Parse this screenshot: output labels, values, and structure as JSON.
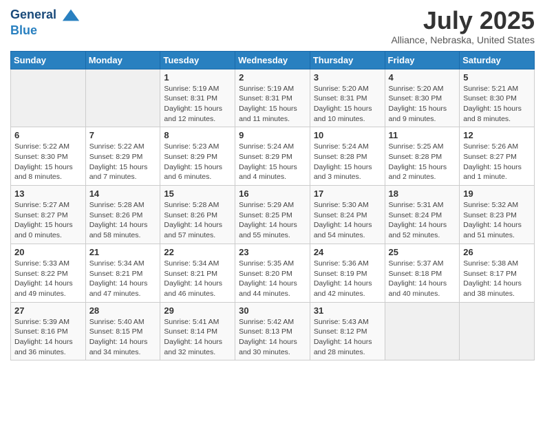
{
  "logo": {
    "line1": "General",
    "line2": "Blue"
  },
  "title": "July 2025",
  "location": "Alliance, Nebraska, United States",
  "days_header": [
    "Sunday",
    "Monday",
    "Tuesday",
    "Wednesday",
    "Thursday",
    "Friday",
    "Saturday"
  ],
  "weeks": [
    [
      {
        "num": "",
        "detail": ""
      },
      {
        "num": "",
        "detail": ""
      },
      {
        "num": "1",
        "detail": "Sunrise: 5:19 AM\nSunset: 8:31 PM\nDaylight: 15 hours\nand 12 minutes."
      },
      {
        "num": "2",
        "detail": "Sunrise: 5:19 AM\nSunset: 8:31 PM\nDaylight: 15 hours\nand 11 minutes."
      },
      {
        "num": "3",
        "detail": "Sunrise: 5:20 AM\nSunset: 8:31 PM\nDaylight: 15 hours\nand 10 minutes."
      },
      {
        "num": "4",
        "detail": "Sunrise: 5:20 AM\nSunset: 8:30 PM\nDaylight: 15 hours\nand 9 minutes."
      },
      {
        "num": "5",
        "detail": "Sunrise: 5:21 AM\nSunset: 8:30 PM\nDaylight: 15 hours\nand 8 minutes."
      }
    ],
    [
      {
        "num": "6",
        "detail": "Sunrise: 5:22 AM\nSunset: 8:30 PM\nDaylight: 15 hours\nand 8 minutes."
      },
      {
        "num": "7",
        "detail": "Sunrise: 5:22 AM\nSunset: 8:29 PM\nDaylight: 15 hours\nand 7 minutes."
      },
      {
        "num": "8",
        "detail": "Sunrise: 5:23 AM\nSunset: 8:29 PM\nDaylight: 15 hours\nand 6 minutes."
      },
      {
        "num": "9",
        "detail": "Sunrise: 5:24 AM\nSunset: 8:29 PM\nDaylight: 15 hours\nand 4 minutes."
      },
      {
        "num": "10",
        "detail": "Sunrise: 5:24 AM\nSunset: 8:28 PM\nDaylight: 15 hours\nand 3 minutes."
      },
      {
        "num": "11",
        "detail": "Sunrise: 5:25 AM\nSunset: 8:28 PM\nDaylight: 15 hours\nand 2 minutes."
      },
      {
        "num": "12",
        "detail": "Sunrise: 5:26 AM\nSunset: 8:27 PM\nDaylight: 15 hours\nand 1 minute."
      }
    ],
    [
      {
        "num": "13",
        "detail": "Sunrise: 5:27 AM\nSunset: 8:27 PM\nDaylight: 15 hours\nand 0 minutes."
      },
      {
        "num": "14",
        "detail": "Sunrise: 5:28 AM\nSunset: 8:26 PM\nDaylight: 14 hours\nand 58 minutes."
      },
      {
        "num": "15",
        "detail": "Sunrise: 5:28 AM\nSunset: 8:26 PM\nDaylight: 14 hours\nand 57 minutes."
      },
      {
        "num": "16",
        "detail": "Sunrise: 5:29 AM\nSunset: 8:25 PM\nDaylight: 14 hours\nand 55 minutes."
      },
      {
        "num": "17",
        "detail": "Sunrise: 5:30 AM\nSunset: 8:24 PM\nDaylight: 14 hours\nand 54 minutes."
      },
      {
        "num": "18",
        "detail": "Sunrise: 5:31 AM\nSunset: 8:24 PM\nDaylight: 14 hours\nand 52 minutes."
      },
      {
        "num": "19",
        "detail": "Sunrise: 5:32 AM\nSunset: 8:23 PM\nDaylight: 14 hours\nand 51 minutes."
      }
    ],
    [
      {
        "num": "20",
        "detail": "Sunrise: 5:33 AM\nSunset: 8:22 PM\nDaylight: 14 hours\nand 49 minutes."
      },
      {
        "num": "21",
        "detail": "Sunrise: 5:34 AM\nSunset: 8:21 PM\nDaylight: 14 hours\nand 47 minutes."
      },
      {
        "num": "22",
        "detail": "Sunrise: 5:34 AM\nSunset: 8:21 PM\nDaylight: 14 hours\nand 46 minutes."
      },
      {
        "num": "23",
        "detail": "Sunrise: 5:35 AM\nSunset: 8:20 PM\nDaylight: 14 hours\nand 44 minutes."
      },
      {
        "num": "24",
        "detail": "Sunrise: 5:36 AM\nSunset: 8:19 PM\nDaylight: 14 hours\nand 42 minutes."
      },
      {
        "num": "25",
        "detail": "Sunrise: 5:37 AM\nSunset: 8:18 PM\nDaylight: 14 hours\nand 40 minutes."
      },
      {
        "num": "26",
        "detail": "Sunrise: 5:38 AM\nSunset: 8:17 PM\nDaylight: 14 hours\nand 38 minutes."
      }
    ],
    [
      {
        "num": "27",
        "detail": "Sunrise: 5:39 AM\nSunset: 8:16 PM\nDaylight: 14 hours\nand 36 minutes."
      },
      {
        "num": "28",
        "detail": "Sunrise: 5:40 AM\nSunset: 8:15 PM\nDaylight: 14 hours\nand 34 minutes."
      },
      {
        "num": "29",
        "detail": "Sunrise: 5:41 AM\nSunset: 8:14 PM\nDaylight: 14 hours\nand 32 minutes."
      },
      {
        "num": "30",
        "detail": "Sunrise: 5:42 AM\nSunset: 8:13 PM\nDaylight: 14 hours\nand 30 minutes."
      },
      {
        "num": "31",
        "detail": "Sunrise: 5:43 AM\nSunset: 8:12 PM\nDaylight: 14 hours\nand 28 minutes."
      },
      {
        "num": "",
        "detail": ""
      },
      {
        "num": "",
        "detail": ""
      }
    ]
  ]
}
